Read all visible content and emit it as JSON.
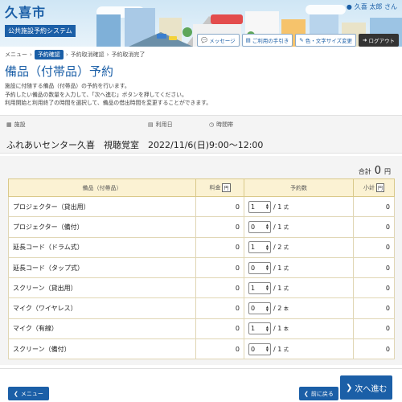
{
  "header": {
    "city": "久喜市",
    "system": "公共施設予約システム",
    "user": "久喜 太郎 さん",
    "buttons": {
      "message": "メッセージ",
      "usage": "ご利用の手引き",
      "color": "色・文字サイズ変更",
      "logout": "ログアウト"
    }
  },
  "breadcrumb": [
    "メニュー",
    "予約確認",
    "予約取消確認",
    "予約取消完了"
  ],
  "page": {
    "title": "備品（付帯品）予約",
    "desc": [
      "施設に付随する備品（付帯品）の予約を行います。",
      "予約したい備品の数量を入力して、「次へ進む」ボタンを押してください。",
      "利用開始と利用終了の時間を選択して、備品の借出時間を変更することができます。"
    ]
  },
  "info": {
    "facility_label": "施設",
    "facility": "ふれあいセンター久喜　視聴覚室",
    "date_label": "利用日",
    "date": "2022/11/6(日)",
    "time_label": "時間帯",
    "time": "9:00～12:00"
  },
  "total": {
    "label": "合計",
    "value": "0",
    "unit": "円"
  },
  "table": {
    "headers": {
      "name": "備品（付帯品）",
      "fee": "料金",
      "qty": "予約数",
      "subtotal": "小計",
      "yen": "円"
    },
    "rows": [
      {
        "name": "プロジェクター（貸出用）",
        "fee": "0",
        "qty": "1",
        "max": "/ 1",
        "unit": "式",
        "subtotal": "0"
      },
      {
        "name": "プロジェクター（備付）",
        "fee": "0",
        "qty": "0",
        "max": "/ 1",
        "unit": "式",
        "subtotal": "0"
      },
      {
        "name": "延長コード（ドラム式）",
        "fee": "0",
        "qty": "1",
        "max": "/ 2",
        "unit": "式",
        "subtotal": "0"
      },
      {
        "name": "延長コード（タップ式）",
        "fee": "0",
        "qty": "0",
        "max": "/ 1",
        "unit": "式",
        "subtotal": "0"
      },
      {
        "name": "スクリーン（貸出用）",
        "fee": "0",
        "qty": "1",
        "max": "/ 1",
        "unit": "式",
        "subtotal": "0"
      },
      {
        "name": "マイク（ワイヤレス）",
        "fee": "0",
        "qty": "0",
        "max": "/ 2",
        "unit": "本",
        "subtotal": "0"
      },
      {
        "name": "マイク（有線）",
        "fee": "0",
        "qty": "1",
        "max": "/ 1",
        "unit": "本",
        "subtotal": "0"
      },
      {
        "name": "スクリーン（備付）",
        "fee": "0",
        "qty": "0",
        "max": "/ 1",
        "unit": "式",
        "subtotal": "0"
      }
    ]
  },
  "footer": {
    "menu": "メニュー",
    "back": "前に戻る",
    "next": "次へ進む"
  },
  "colors": {
    "brand": "#1b5fa7",
    "table_header": "#fbf2d3"
  }
}
